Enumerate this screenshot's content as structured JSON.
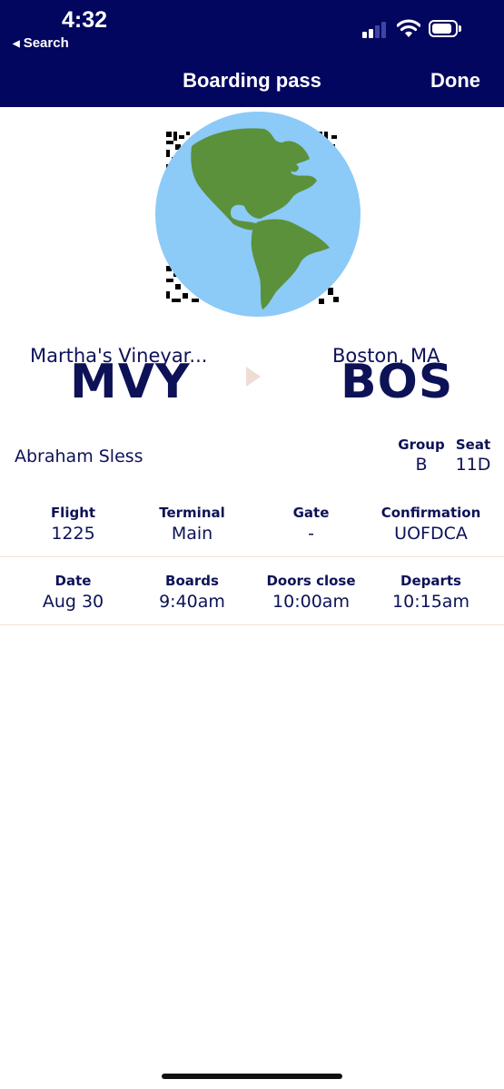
{
  "status_bar": {
    "time": "4:32",
    "back_label": "Search"
  },
  "header": {
    "title": "Boarding pass",
    "done_label": "Done"
  },
  "route": {
    "origin_city": "Martha's Vineyar...",
    "origin_code": "MVY",
    "destination_city": "Boston, MA",
    "destination_code": "BOS"
  },
  "passenger": {
    "name": "Abraham Sless",
    "group_label": "Group",
    "group_value": "B",
    "seat_label": "Seat",
    "seat_value": "11D"
  },
  "details_row1": [
    {
      "label": "Flight",
      "value": "1225"
    },
    {
      "label": "Terminal",
      "value": "Main"
    },
    {
      "label": "Gate",
      "value": "-"
    },
    {
      "label": "Confirmation",
      "value": "UOFDCA"
    }
  ],
  "details_row2": [
    {
      "label": "Date",
      "value": "Aug 30"
    },
    {
      "label": "Boards",
      "value": "9:40am"
    },
    {
      "label": "Doors close",
      "value": "10:00am"
    },
    {
      "label": "Departs",
      "value": "10:15am"
    }
  ],
  "colors": {
    "header_bg": "#02065f",
    "text": "#0d1257",
    "divider": "#f1e3d6"
  },
  "icons": [
    "back-arrow-icon",
    "signal-icon",
    "wifi-icon",
    "battery-icon",
    "globe-icon",
    "route-arrow-icon"
  ]
}
